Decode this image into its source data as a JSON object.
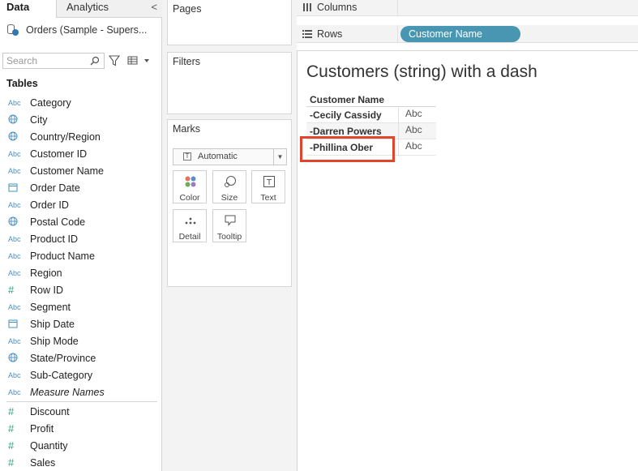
{
  "tabs": {
    "data": "Data",
    "analytics": "Analytics",
    "collapse": "<"
  },
  "datasource": {
    "name": "Orders (Sample - Supers..."
  },
  "search": {
    "placeholder": "Search"
  },
  "tables_header": "Tables",
  "dimensions": [
    {
      "type": "Abc",
      "icon": "abc",
      "name": "Category"
    },
    {
      "type": "globe",
      "icon": "globe",
      "name": "City"
    },
    {
      "type": "globe",
      "icon": "globe",
      "name": "Country/Region"
    },
    {
      "type": "Abc",
      "icon": "abc",
      "name": "Customer ID"
    },
    {
      "type": "Abc",
      "icon": "abc",
      "name": "Customer Name"
    },
    {
      "type": "date",
      "icon": "calendar",
      "name": "Order Date"
    },
    {
      "type": "Abc",
      "icon": "abc",
      "name": "Order ID"
    },
    {
      "type": "globe",
      "icon": "globe",
      "name": "Postal Code"
    },
    {
      "type": "Abc",
      "icon": "abc",
      "name": "Product ID"
    },
    {
      "type": "Abc",
      "icon": "abc",
      "name": "Product Name"
    },
    {
      "type": "Abc",
      "icon": "abc",
      "name": "Region"
    },
    {
      "type": "#",
      "icon": "hash",
      "name": "Row ID"
    },
    {
      "type": "Abc",
      "icon": "abc",
      "name": "Segment"
    },
    {
      "type": "date",
      "icon": "calendar",
      "name": "Ship Date"
    },
    {
      "type": "Abc",
      "icon": "abc",
      "name": "Ship Mode"
    },
    {
      "type": "globe",
      "icon": "globe",
      "name": "State/Province"
    },
    {
      "type": "Abc",
      "icon": "abc",
      "name": "Sub-Category"
    },
    {
      "type": "Abc",
      "icon": "abc",
      "name": "Measure Names"
    }
  ],
  "measures": [
    {
      "type": "#",
      "icon": "hash",
      "name": "Discount"
    },
    {
      "type": "#",
      "icon": "hash",
      "name": "Profit"
    },
    {
      "type": "#",
      "icon": "hash",
      "name": "Quantity"
    },
    {
      "type": "#",
      "icon": "hash",
      "name": "Sales"
    }
  ],
  "cards": {
    "pages": "Pages",
    "filters": "Filters",
    "marks": "Marks",
    "mark_type": "Automatic",
    "mark_buttons": [
      "Color",
      "Size",
      "Text",
      "Detail",
      "Tooltip"
    ]
  },
  "shelves": {
    "columns": "Columns",
    "rows": "Rows",
    "rows_pill": "Customer Name"
  },
  "viz": {
    "title": "Customers (string) with a dash",
    "column_header": "Customer Name",
    "rows": [
      {
        "name": "-Cecily Cassidy",
        "value": "Abc"
      },
      {
        "name": "-Darren Powers",
        "value": "Abc"
      },
      {
        "name": "-Phillina Ober",
        "value": "Abc"
      }
    ]
  },
  "colors": {
    "pill": "#4996b2",
    "highlight": "#e0462d",
    "dimension_icon": "#4a8fc1",
    "measure_icon": "#3aa17e"
  }
}
